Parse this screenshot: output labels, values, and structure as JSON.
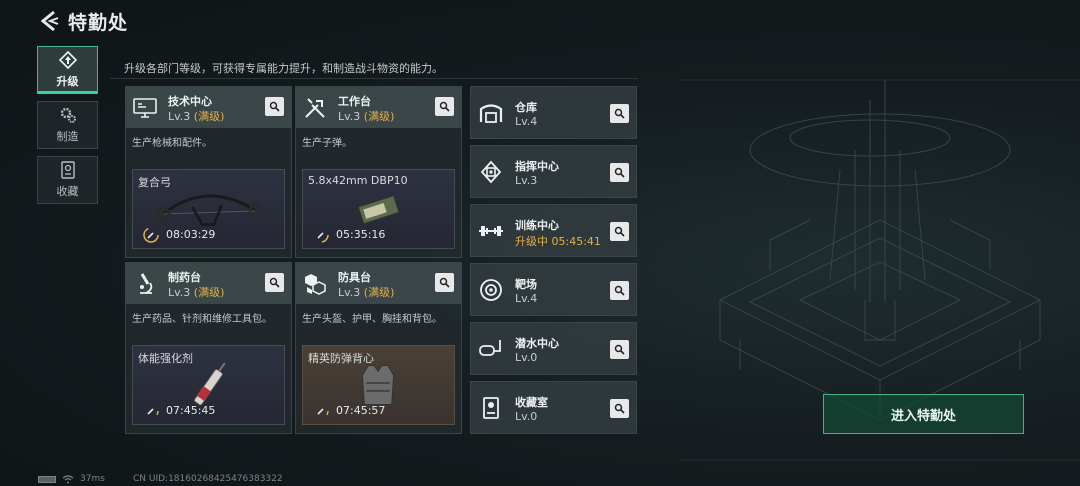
{
  "header": {
    "title": "特勤处"
  },
  "intro": "升级各部门等级，可获得专属能力提升，和制造战斗物资的能力。",
  "side_tabs": [
    {
      "label": "升级",
      "icon": "upgrade-icon",
      "active": true
    },
    {
      "label": "制造",
      "icon": "gears-icon",
      "active": false
    },
    {
      "label": "收藏",
      "icon": "collection-icon",
      "active": false
    }
  ],
  "workshops": [
    {
      "name": "技术中心",
      "level": "Lv.3",
      "status": "(满级)",
      "desc": "生产枪械和配件。",
      "craft_item": "复合弓",
      "timer": "08:03:29",
      "icon": "monitor-icon"
    },
    {
      "name": "工作台",
      "level": "Lv.3",
      "status": "(满级)",
      "desc": "生产子弹。",
      "craft_item": "5.8x42mm DBP10",
      "timer": "05:35:16",
      "icon": "tools-icon"
    },
    {
      "name": "制药台",
      "level": "Lv.3",
      "status": "(满级)",
      "desc": "生产药品、针剂和维修工具包。",
      "craft_item": "体能强化剂",
      "timer": "07:45:45",
      "icon": "microscope-icon"
    },
    {
      "name": "防具台",
      "level": "Lv.3",
      "status": "(满级)",
      "desc": "生产头盔、护甲、胸挂和背包。",
      "craft_item": "精英防弹背心",
      "timer": "07:45:57",
      "icon": "armor-blocks-icon"
    }
  ],
  "facilities": [
    {
      "name": "仓库",
      "level": "Lv.4",
      "upgrading": false,
      "icon": "warehouse-icon"
    },
    {
      "name": "指挥中心",
      "level": "Lv.3",
      "upgrading": false,
      "icon": "chip-icon"
    },
    {
      "name": "训练中心",
      "level": "升级中 05:45:41",
      "upgrading": true,
      "icon": "dumbbell-icon"
    },
    {
      "name": "靶场",
      "level": "Lv.4",
      "upgrading": false,
      "icon": "target-icon"
    },
    {
      "name": "潜水中心",
      "level": "Lv.0",
      "upgrading": false,
      "icon": "dive-mask-icon"
    },
    {
      "name": "收藏室",
      "level": "Lv.0",
      "upgrading": false,
      "icon": "display-case-icon"
    }
  ],
  "enter_button": "进入特勤处",
  "footer": {
    "ping": "37ms",
    "uid": "CN UID:18160268425476383322"
  },
  "colors": {
    "accent_green": "#36d39a",
    "maxed_gold": "#e3b04b",
    "panel": "#222a2e"
  }
}
